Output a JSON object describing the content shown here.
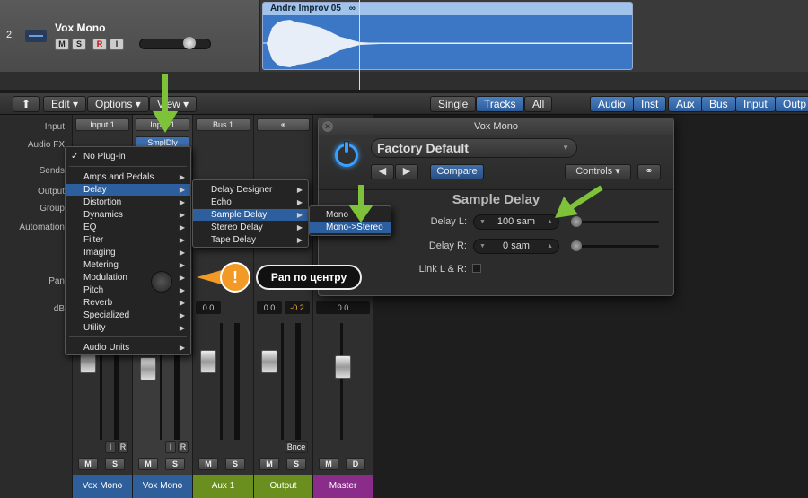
{
  "track": {
    "number": "2",
    "name": "Vox Mono",
    "buttons": [
      "M",
      "S",
      "R",
      "I"
    ],
    "region_title": "Andre Improv 05"
  },
  "toolbar": {
    "back_icon": "up-arrow-icon",
    "edit": "Edit",
    "options": "Options",
    "view": "View",
    "single": "Single",
    "tracks": "Tracks",
    "all": "All",
    "filters": [
      "Audio",
      "Inst",
      "Aux",
      "Bus",
      "Input",
      "Outp"
    ]
  },
  "mixer": {
    "row_labels": [
      "Input",
      "Audio FX",
      "Sends",
      "Output",
      "Group",
      "Automation",
      "Pan",
      "dB"
    ],
    "strips": [
      {
        "name": "Vox Mono",
        "input": "Input 1",
        "value": "",
        "color": "#2f5f9a"
      },
      {
        "name": "Vox Mono",
        "input": "Input 1",
        "fx": "SmplDly",
        "value": "",
        "color": "#2f5f9a"
      },
      {
        "name": "Aux 1",
        "input": "Bus 1",
        "value": "0.0",
        "color": "#6a8f1e"
      },
      {
        "name": "Output",
        "input": "",
        "value": "0.0",
        "value2": "-0.2",
        "bnce": "Bnce",
        "color": "#6a8f1e"
      },
      {
        "name": "Master",
        "input": "",
        "value": "0.0",
        "color": "#8a2c8a"
      }
    ],
    "ms": [
      "M",
      "S"
    ],
    "ir": [
      "I",
      "R"
    ],
    "master_buttons": [
      "M",
      "D"
    ]
  },
  "plugin": {
    "title": "Vox Mono",
    "preset": "Factory Default",
    "compare": "Compare",
    "controls": "Controls",
    "name": "Sample Delay",
    "params": [
      {
        "label": "Delay L:",
        "value": "100 sam"
      },
      {
        "label": "Delay R:",
        "value": "0 sam"
      }
    ],
    "link_label": "Link L & R:"
  },
  "menu_main": {
    "items": [
      "No Plug-in",
      "Amps and Pedals",
      "Delay",
      "Distortion",
      "Dynamics",
      "EQ",
      "Filter",
      "Imaging",
      "Metering",
      "Modulation",
      "Pitch",
      "Reverb",
      "Specialized",
      "Utility",
      "Audio Units"
    ]
  },
  "menu_delay": {
    "items": [
      "Delay Designer",
      "Echo",
      "Sample Delay",
      "Stereo Delay",
      "Tape Delay"
    ]
  },
  "menu_sample_delay": {
    "items": [
      "Mono",
      "Mono->Stereo"
    ]
  },
  "callout": {
    "badge": "!",
    "text": "Pan по центру"
  }
}
